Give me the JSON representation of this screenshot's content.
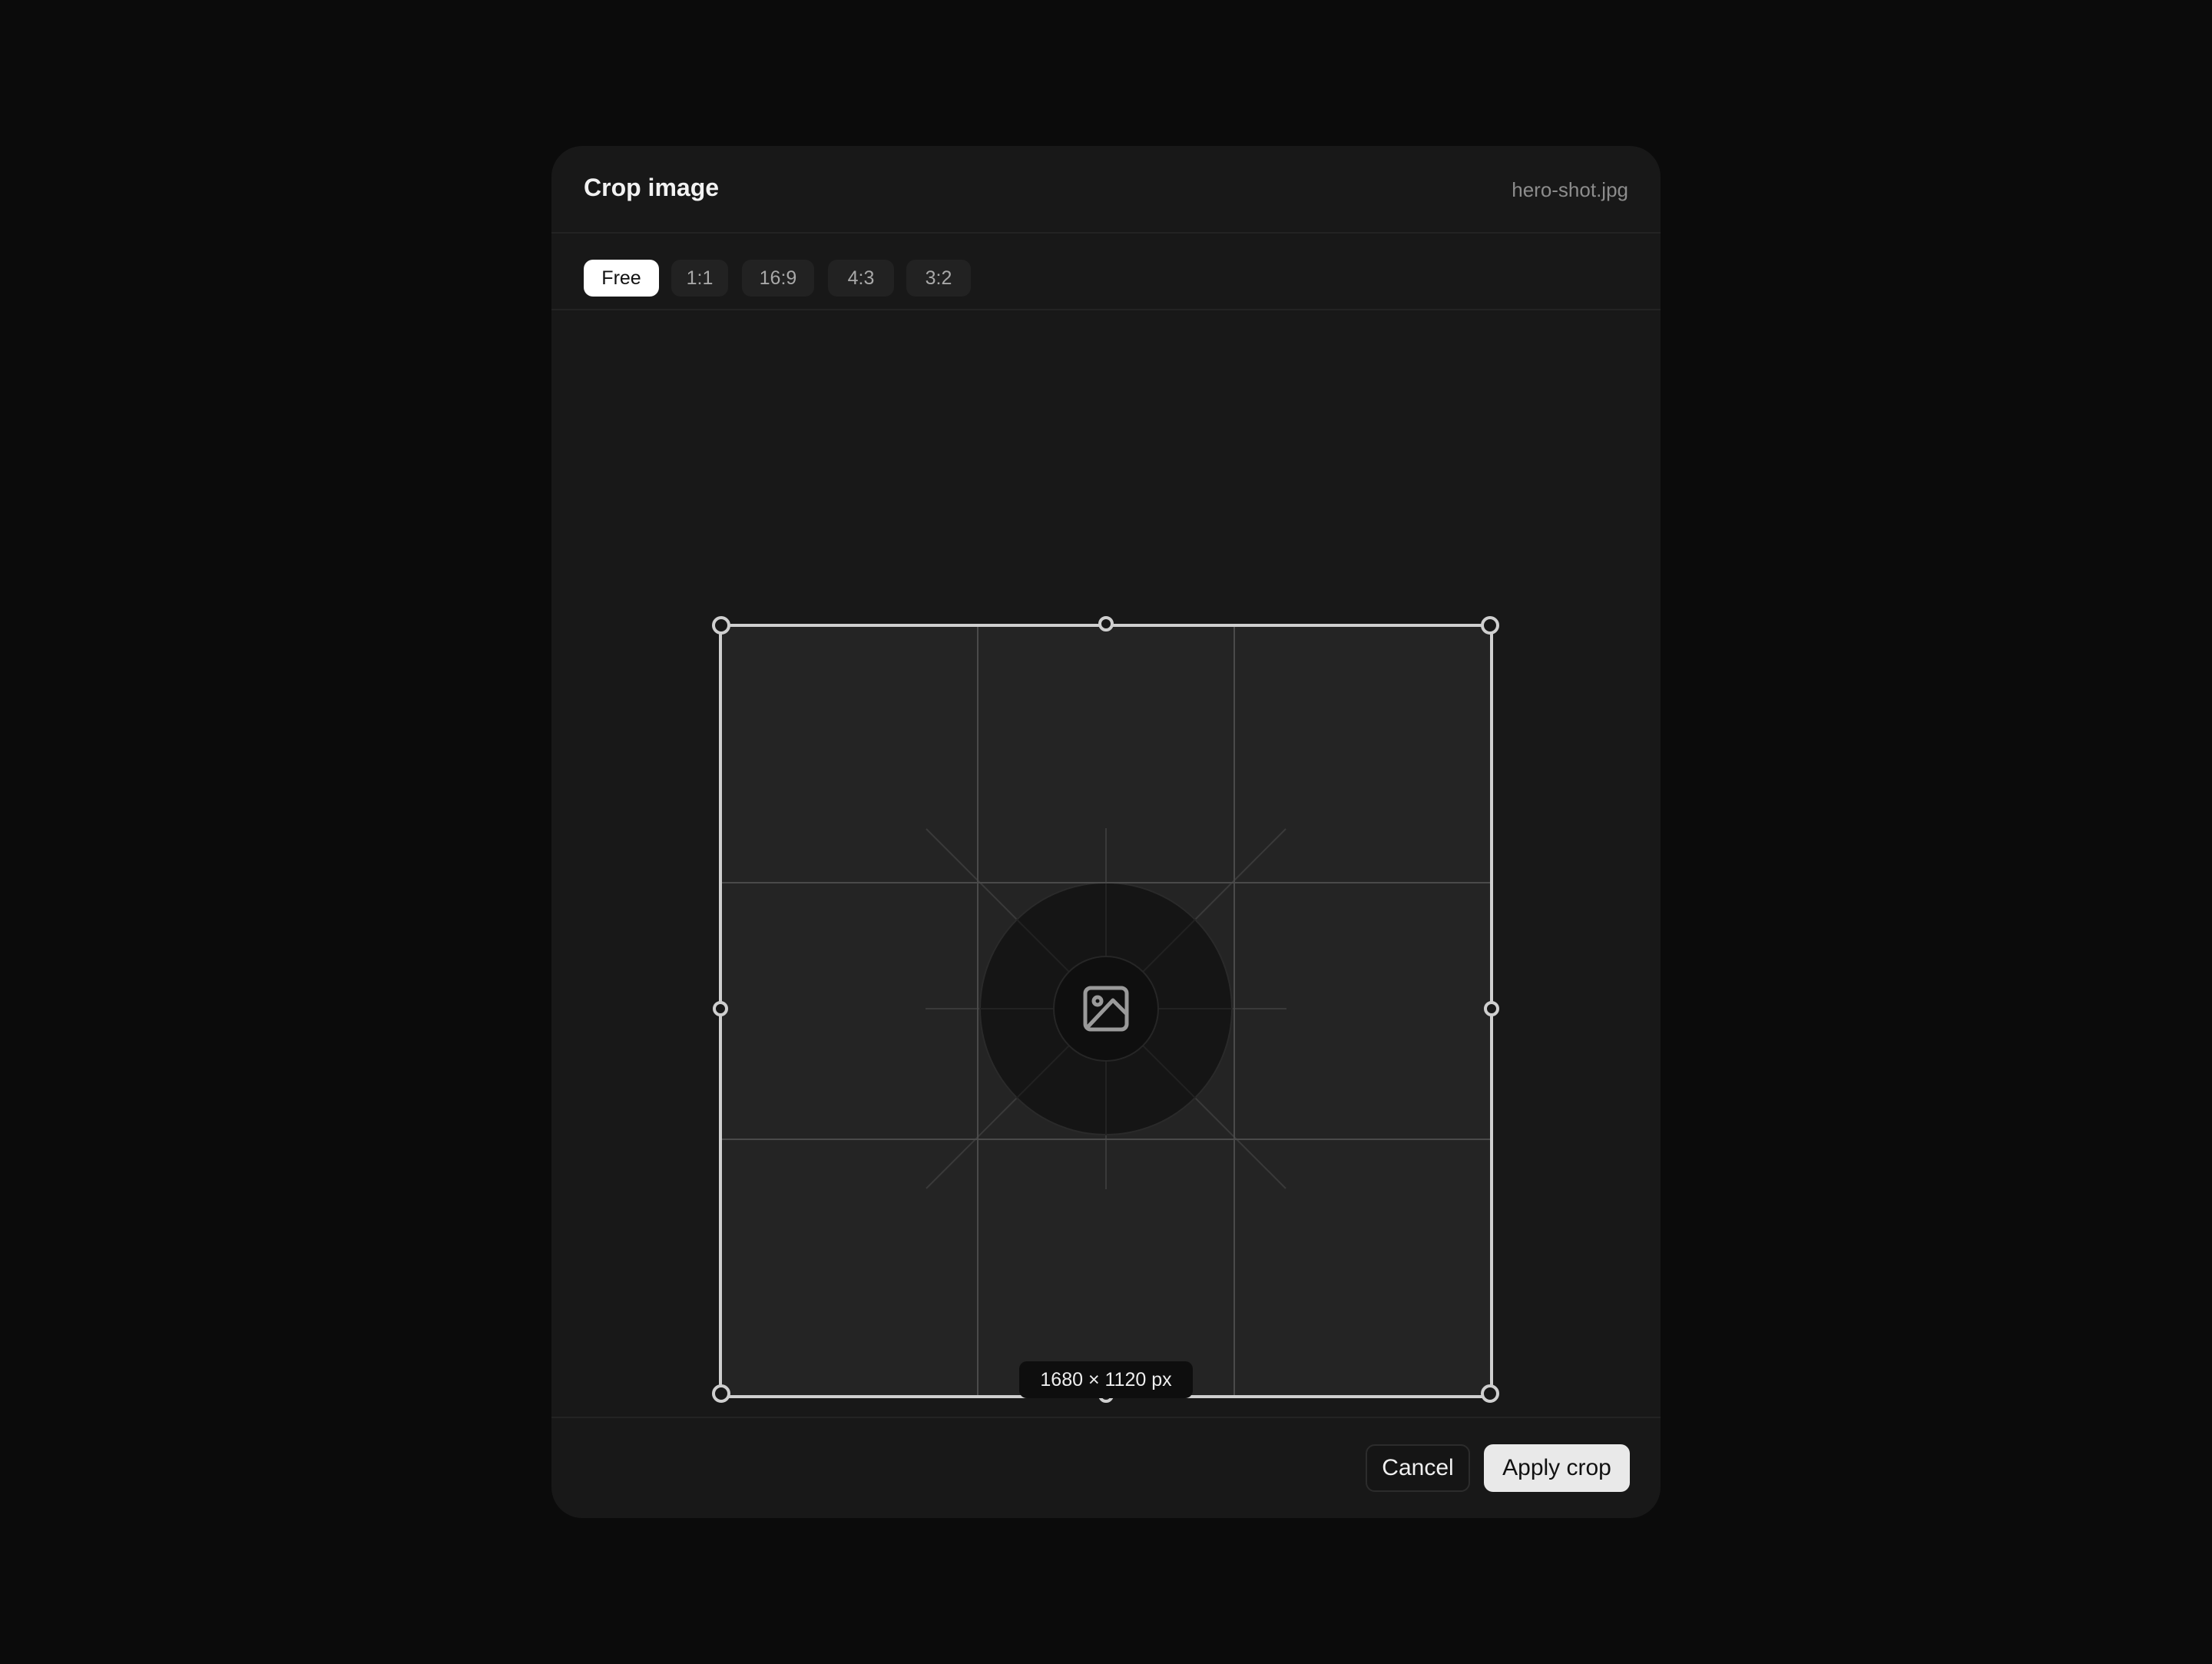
{
  "dialog": {
    "title": "Crop image",
    "filename": "hero-shot.jpg"
  },
  "aspect_ratios": {
    "options": [
      "Free",
      "1:1",
      "16:9",
      "4:3",
      "3:2"
    ],
    "selected": "Free"
  },
  "crop": {
    "dimensions_label": "1680 × 1120 px",
    "placeholder_icon": "image-icon",
    "handles": [
      "top-left",
      "top",
      "top-right",
      "right",
      "bottom-right",
      "bottom",
      "bottom-left",
      "left"
    ]
  },
  "footer": {
    "cancel_label": "Cancel",
    "apply_label": "Apply crop"
  },
  "colors": {
    "background": "#0b0b0b",
    "dialog": "#181818",
    "crop_area": "#242424",
    "accent": "#ffffff"
  }
}
